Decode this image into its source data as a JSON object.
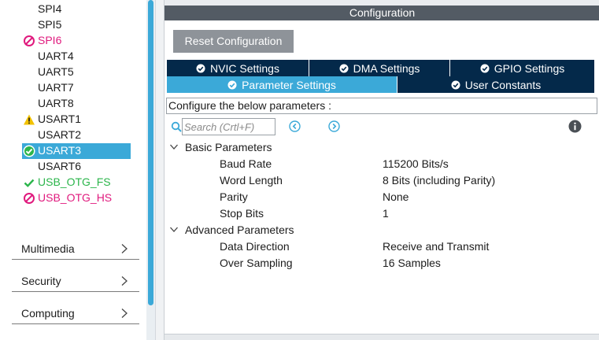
{
  "peripherals": [
    {
      "label": "SPI4",
      "status": "none"
    },
    {
      "label": "SPI5",
      "status": "none"
    },
    {
      "label": "SPI6",
      "status": "disabled"
    },
    {
      "label": "UART4",
      "status": "none"
    },
    {
      "label": "UART5",
      "status": "none"
    },
    {
      "label": "UART7",
      "status": "none"
    },
    {
      "label": "UART8",
      "status": "none"
    },
    {
      "label": "USART1",
      "status": "warning"
    },
    {
      "label": "USART2",
      "status": "none"
    },
    {
      "label": "USART3",
      "status": "configured-selected"
    },
    {
      "label": "USART6",
      "status": "none"
    },
    {
      "label": "USB_OTG_FS",
      "status": "configured"
    },
    {
      "label": "USB_OTG_HS",
      "status": "disabled"
    }
  ],
  "categories": [
    {
      "label": "Multimedia"
    },
    {
      "label": "Security"
    },
    {
      "label": "Computing"
    }
  ],
  "config": {
    "title": "Configuration",
    "reset_label": "Reset Configuration",
    "tabs": {
      "nvic": "NVIC Settings",
      "dma": "DMA Settings",
      "gpio": "GPIO Settings",
      "parameter": "Parameter Settings",
      "user_constants": "User Constants"
    },
    "active_tab": "Parameter Settings",
    "configure_text": "Configure the below parameters :",
    "search_placeholder": "Search (Crtl+F)",
    "groups": [
      {
        "label": "Basic Parameters",
        "params": [
          {
            "name": "Baud Rate",
            "value": "115200 Bits/s"
          },
          {
            "name": "Word Length",
            "value": "8 Bits (including Parity)"
          },
          {
            "name": "Parity",
            "value": "None"
          },
          {
            "name": "Stop Bits",
            "value": "1"
          }
        ]
      },
      {
        "label": "Advanced Parameters",
        "params": [
          {
            "name": "Data Direction",
            "value": "Receive and Transmit"
          },
          {
            "name": "Over Sampling",
            "value": "16 Samples"
          }
        ]
      }
    ]
  },
  "colors": {
    "accent": "#3ba9d8",
    "tab_dark": "#04294a",
    "title_bar": "#535b64",
    "disabled": "#e0197d",
    "configured": "#2bb54b",
    "warning": "#f2c200"
  },
  "icons": {
    "disabled": "prohibited-icon",
    "warning": "warning-triangle-icon",
    "configured": "check-icon",
    "search": "search-icon",
    "previous": "previous-icon",
    "next": "next-icon",
    "info": "info-icon"
  }
}
